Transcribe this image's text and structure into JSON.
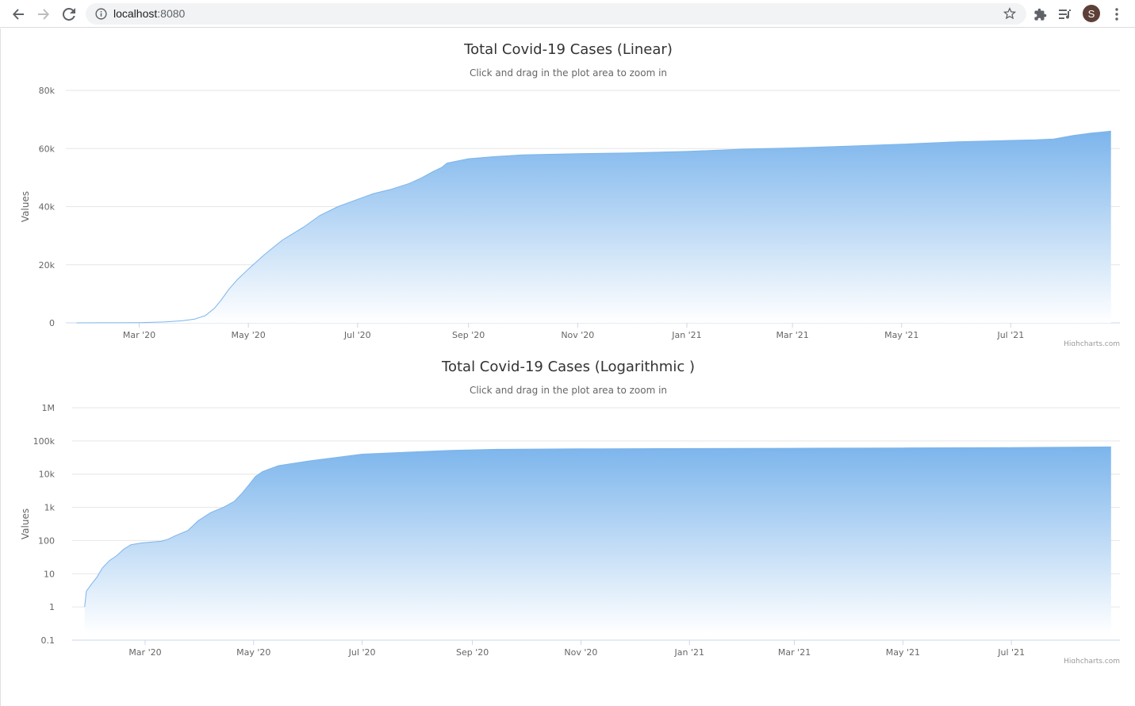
{
  "browser": {
    "url_host": "localhost",
    "url_port": ":8080",
    "avatar_letter": "S",
    "icons": [
      "back-arrow-icon",
      "forward-arrow-icon",
      "reload-icon",
      "info-icon",
      "star-icon",
      "extensions-icon",
      "reading-list-icon",
      "more-vert-icon"
    ]
  },
  "colors": {
    "series_top": "#7cb5ec",
    "series_bottom": "#ffffff",
    "grid": "#e6e6e6",
    "axis_text": "#666666",
    "title": "#333333"
  },
  "credits": "Highcharts.com",
  "chart_data": [
    {
      "type": "area",
      "title": "Total Covid-19 Cases (Linear)",
      "subtitle": "Click and drag in the plot area to zoom in",
      "ylabel": "Values",
      "xlabel": "",
      "scale": "linear",
      "grid": true,
      "ylim": [
        0,
        80000
      ],
      "yticks": [
        0,
        20000,
        40000,
        60000,
        80000
      ],
      "ytick_labels": [
        "0",
        "20k",
        "40k",
        "60k",
        "80k"
      ],
      "xlim": [
        "2020-01-20",
        "2021-08-31"
      ],
      "xticks": [
        "2020-03-01",
        "2020-05-01",
        "2020-07-01",
        "2020-09-01",
        "2020-11-01",
        "2021-01-01",
        "2021-03-01",
        "2021-05-01",
        "2021-07-01"
      ],
      "xtick_labels": [
        "Mar '20",
        "May '20",
        "Jul '20",
        "Sep '20",
        "Nov '20",
        "Jan '21",
        "Mar '21",
        "May '21",
        "Jul '21"
      ],
      "series": [
        {
          "values": [
            [
              "2020-01-26",
              0
            ],
            [
              "2020-02-15",
              20
            ],
            [
              "2020-03-01",
              80
            ],
            [
              "2020-03-15",
              300
            ],
            [
              "2020-03-25",
              700
            ],
            [
              "2020-04-01",
              1300
            ],
            [
              "2020-04-07",
              2500
            ],
            [
              "2020-04-12",
              5000
            ],
            [
              "2020-04-16",
              8000
            ],
            [
              "2020-04-20",
              11500
            ],
            [
              "2020-04-25",
              15000
            ],
            [
              "2020-05-01",
              18500
            ],
            [
              "2020-05-10",
              23500
            ],
            [
              "2020-05-20",
              28500
            ],
            [
              "2020-06-01",
              33000
            ],
            [
              "2020-06-10",
              37000
            ],
            [
              "2020-06-20",
              40000
            ],
            [
              "2020-07-01",
              42500
            ],
            [
              "2020-07-10",
              44500
            ],
            [
              "2020-07-20",
              46000
            ],
            [
              "2020-07-30",
              48000
            ],
            [
              "2020-08-06",
              50000
            ],
            [
              "2020-08-12",
              52000
            ],
            [
              "2020-08-17",
              53500
            ],
            [
              "2020-08-20",
              55000
            ],
            [
              "2020-09-01",
              56500
            ],
            [
              "2020-09-15",
              57200
            ],
            [
              "2020-10-01",
              57800
            ],
            [
              "2020-11-01",
              58200
            ],
            [
              "2020-12-01",
              58500
            ],
            [
              "2021-01-01",
              59000
            ],
            [
              "2021-02-01",
              59800
            ],
            [
              "2021-03-01",
              60200
            ],
            [
              "2021-04-01",
              60800
            ],
            [
              "2021-05-01",
              61500
            ],
            [
              "2021-06-01",
              62300
            ],
            [
              "2021-07-01",
              62800
            ],
            [
              "2021-07-15",
              63000
            ],
            [
              "2021-07-25",
              63300
            ],
            [
              "2021-08-05",
              64500
            ],
            [
              "2021-08-15",
              65300
            ],
            [
              "2021-08-26",
              66000
            ]
          ]
        }
      ]
    },
    {
      "type": "area",
      "title": "Total Covid-19 Cases (Logarithmic )",
      "subtitle": "Click and drag in the plot area to zoom in",
      "ylabel": "Values",
      "xlabel": "",
      "scale": "log",
      "grid": true,
      "ylim": [
        0.1,
        1000000
      ],
      "yticks": [
        0.1,
        1,
        10,
        100,
        1000,
        10000,
        100000,
        1000000
      ],
      "ytick_labels": [
        "0.1",
        "1",
        "10",
        "100",
        "1k",
        "10k",
        "100k",
        "1M"
      ],
      "xlim": [
        "2020-01-20",
        "2021-08-31"
      ],
      "xticks": [
        "2020-03-01",
        "2020-05-01",
        "2020-07-01",
        "2020-09-01",
        "2020-11-01",
        "2021-01-01",
        "2021-03-01",
        "2021-05-01",
        "2021-07-01"
      ],
      "xtick_labels": [
        "Mar '20",
        "May '20",
        "Jul '20",
        "Sep '20",
        "Nov '20",
        "Jan '21",
        "Mar '21",
        "May '21",
        "Jul '21"
      ],
      "series": [
        {
          "values": [
            [
              "2020-01-27",
              1
            ],
            [
              "2020-01-28",
              3
            ],
            [
              "2020-01-31",
              5
            ],
            [
              "2020-02-03",
              8
            ],
            [
              "2020-02-06",
              15
            ],
            [
              "2020-02-10",
              25
            ],
            [
              "2020-02-14",
              35
            ],
            [
              "2020-02-18",
              55
            ],
            [
              "2020-02-22",
              75
            ],
            [
              "2020-02-28",
              85
            ],
            [
              "2020-03-05",
              90
            ],
            [
              "2020-03-10",
              95
            ],
            [
              "2020-03-14",
              110
            ],
            [
              "2020-03-18",
              140
            ],
            [
              "2020-03-25",
              200
            ],
            [
              "2020-03-31",
              400
            ],
            [
              "2020-04-07",
              700
            ],
            [
              "2020-04-14",
              1000
            ],
            [
              "2020-04-20",
              1500
            ],
            [
              "2020-04-24",
              2500
            ],
            [
              "2020-04-28",
              4500
            ],
            [
              "2020-05-02",
              8500
            ],
            [
              "2020-05-06",
              12000
            ],
            [
              "2020-05-15",
              18000
            ],
            [
              "2020-06-01",
              25000
            ],
            [
              "2020-07-01",
              40000
            ],
            [
              "2020-08-20",
              52000
            ],
            [
              "2020-09-15",
              56000
            ],
            [
              "2020-11-01",
              58000
            ],
            [
              "2021-01-01",
              59000
            ],
            [
              "2021-03-01",
              60000
            ],
            [
              "2021-05-01",
              61500
            ],
            [
              "2021-07-01",
              63000
            ],
            [
              "2021-08-26",
              66000
            ]
          ]
        }
      ]
    }
  ]
}
